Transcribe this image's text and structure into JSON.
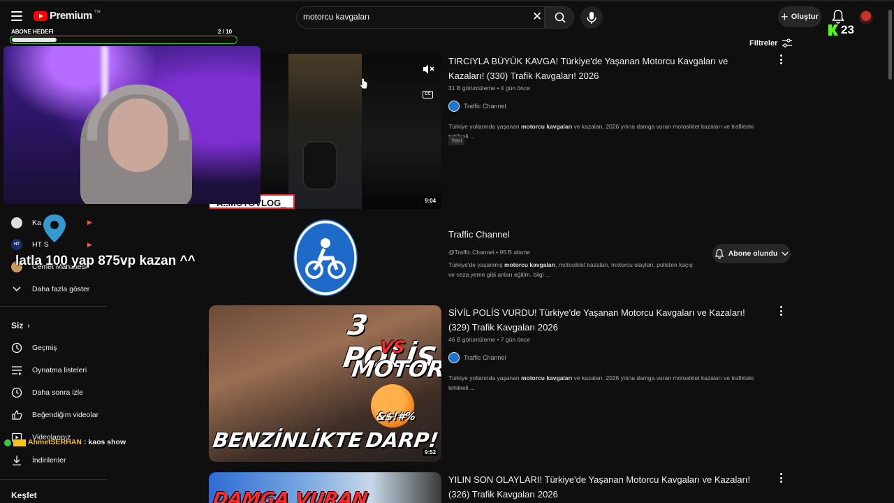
{
  "header": {
    "logo_text": "Premium",
    "logo_suffix": "TR",
    "search_value": "motorcu kavgaları",
    "create_label": "Oluştur",
    "kick_count": "23",
    "filters_label": "Filtreler"
  },
  "overlay": {
    "goal_label": "ABONE HEDEFİ",
    "goal_count": "2 / 10",
    "goal_progress": 0.2,
    "promo_text": "latla 100 yap 875vp kazan ^^",
    "chat_user": "AhmetSERHAN",
    "chat_message": ": kaos show",
    "vlog_banner": "A..MOTOVLOG_"
  },
  "results": [
    {
      "title": "TIRCIYLA BÜYÜK KAVGA! Türkiye'de Yaşanan Motorcu Kavgaları ve Kazaları! (330) Trafik Kavgaları! 2026",
      "meta": "31 B görüntüleme • 4 gün önce",
      "channel": "Traffic Channel",
      "snippet_pre": "Türkiye yollarında yaşanan ",
      "snippet_bold": "motorcu kavgaları",
      "snippet_post": " ve kazaları, 2026 yılına damga vuran motosiklet kazaları ve trafikteki tehlikeli ...",
      "badge": "Yeni",
      "duration": "9:04"
    },
    {
      "title": "SİVİL POLİS VURDU! Türkiye'de Yaşanan Motorcu Kavgaları ve Kazaları! (329) Trafik Kavgaları 2026",
      "meta": "46 B görüntüleme • 7 gün önce",
      "channel": "Traffic Channel",
      "snippet_pre": "Türkiye yollarında yaşanan ",
      "snippet_bold": "motorcu kavgaları",
      "snippet_post": " ve kazaları, 2026 yılına damga vuran motosiklet kazaları ve trafikteki tehlikeli ...",
      "duration": "9:52",
      "thumb_top": "3 POLİS",
      "thumb_vs": "VS",
      "thumb_mid": "MOTORCU!",
      "thumb_left": "BENZİNLİKTE",
      "thumb_right": "DARP!",
      "thumb_symbols": "&$!#%"
    },
    {
      "title": "YILIN SON OLAYLARI! Türkiye'de Yaşanan Motorcu Kavgaları ve Kazaları! (326) Trafik Kavgaları 2026",
      "thumb_text": "DAMGA VURAN"
    }
  ],
  "channel_card": {
    "name": "Traffic Channel",
    "meta": "@Traffic.Channel • 95 B abone",
    "snippet_pre": "Türkiye'de yaşanmış ",
    "snippet_bold": "motorcu kavgaları",
    "snippet_post": ", motosiklet kazaları, motorcu olayları, polisten kaçış ve ceza yeme gibi anları eğitim, bilgi ...",
    "subscribe_label": "Abone olundu"
  },
  "sidebar": {
    "subs": [
      {
        "label": "Ka",
        "icon": "channel-avatar"
      },
      {
        "label": "HT S",
        "icon": "ht-avatar"
      },
      {
        "label": "Cemet Mahallesi",
        "icon": "channel-avatar"
      }
    ],
    "show_more": "Daha fazla göster",
    "you_label": "Siz",
    "you_items": [
      {
        "label": "Geçmiş",
        "icon": "history-icon"
      },
      {
        "label": "Oynatma listeleri",
        "icon": "playlist-icon"
      },
      {
        "label": "Daha sonra izle",
        "icon": "clock-icon"
      },
      {
        "label": "Beğendiğim videolar",
        "icon": "thumb-up-icon"
      },
      {
        "label": "Videolarınız",
        "icon": "video-icon"
      },
      {
        "label": "İndirilenler",
        "icon": "download-icon"
      }
    ],
    "explore_label": "Keşfet"
  },
  "colors": {
    "background": "#0f0f0f",
    "accent_red": "#ff0000",
    "kick_green": "#53fc18",
    "goal_border": "#3cc93c"
  }
}
